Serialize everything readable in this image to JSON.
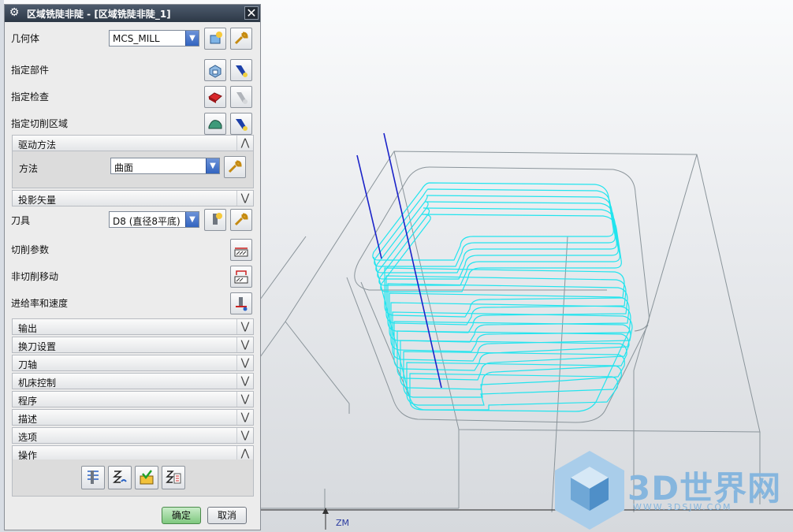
{
  "dialog": {
    "title": "区域铣陡非陡 - [区域铣陡非陡_1]",
    "close_glyph": "✕",
    "geometry": {
      "label": "几何体",
      "value": "MCS_MILL"
    },
    "specify_part": {
      "label": "指定部件"
    },
    "specify_check": {
      "label": "指定检查"
    },
    "specify_cut_area": {
      "label": "指定切削区域"
    },
    "drive_method": {
      "title": "驱动方法",
      "method_label": "方法",
      "method_value": "曲面"
    },
    "projection_vector": {
      "title": "投影矢量"
    },
    "tool": {
      "label": "刀具",
      "value": "D8 (直径8平底)"
    },
    "cutting_params": {
      "label": "切削参数"
    },
    "non_cutting_moves": {
      "label": "非切削移动"
    },
    "feeds_speeds": {
      "label": "进给率和速度"
    },
    "sections": [
      "输出",
      "换刀设置",
      "刀轴",
      "机床控制",
      "程序",
      "描述",
      "选项"
    ],
    "actions": {
      "title": "操作"
    },
    "ok_label": "确定",
    "cancel_label": "取消"
  },
  "viewport": {
    "axis_label": "ZM",
    "axis_z": "Z"
  },
  "watermark": {
    "brand": "3D世界网",
    "url": "WWW.3DSJW.COM"
  },
  "colors": {
    "toolpath": "#22e4ee",
    "tool_axis": "#1a22c8",
    "wireframe": "#8a949a",
    "watermark": "#86b6de"
  }
}
